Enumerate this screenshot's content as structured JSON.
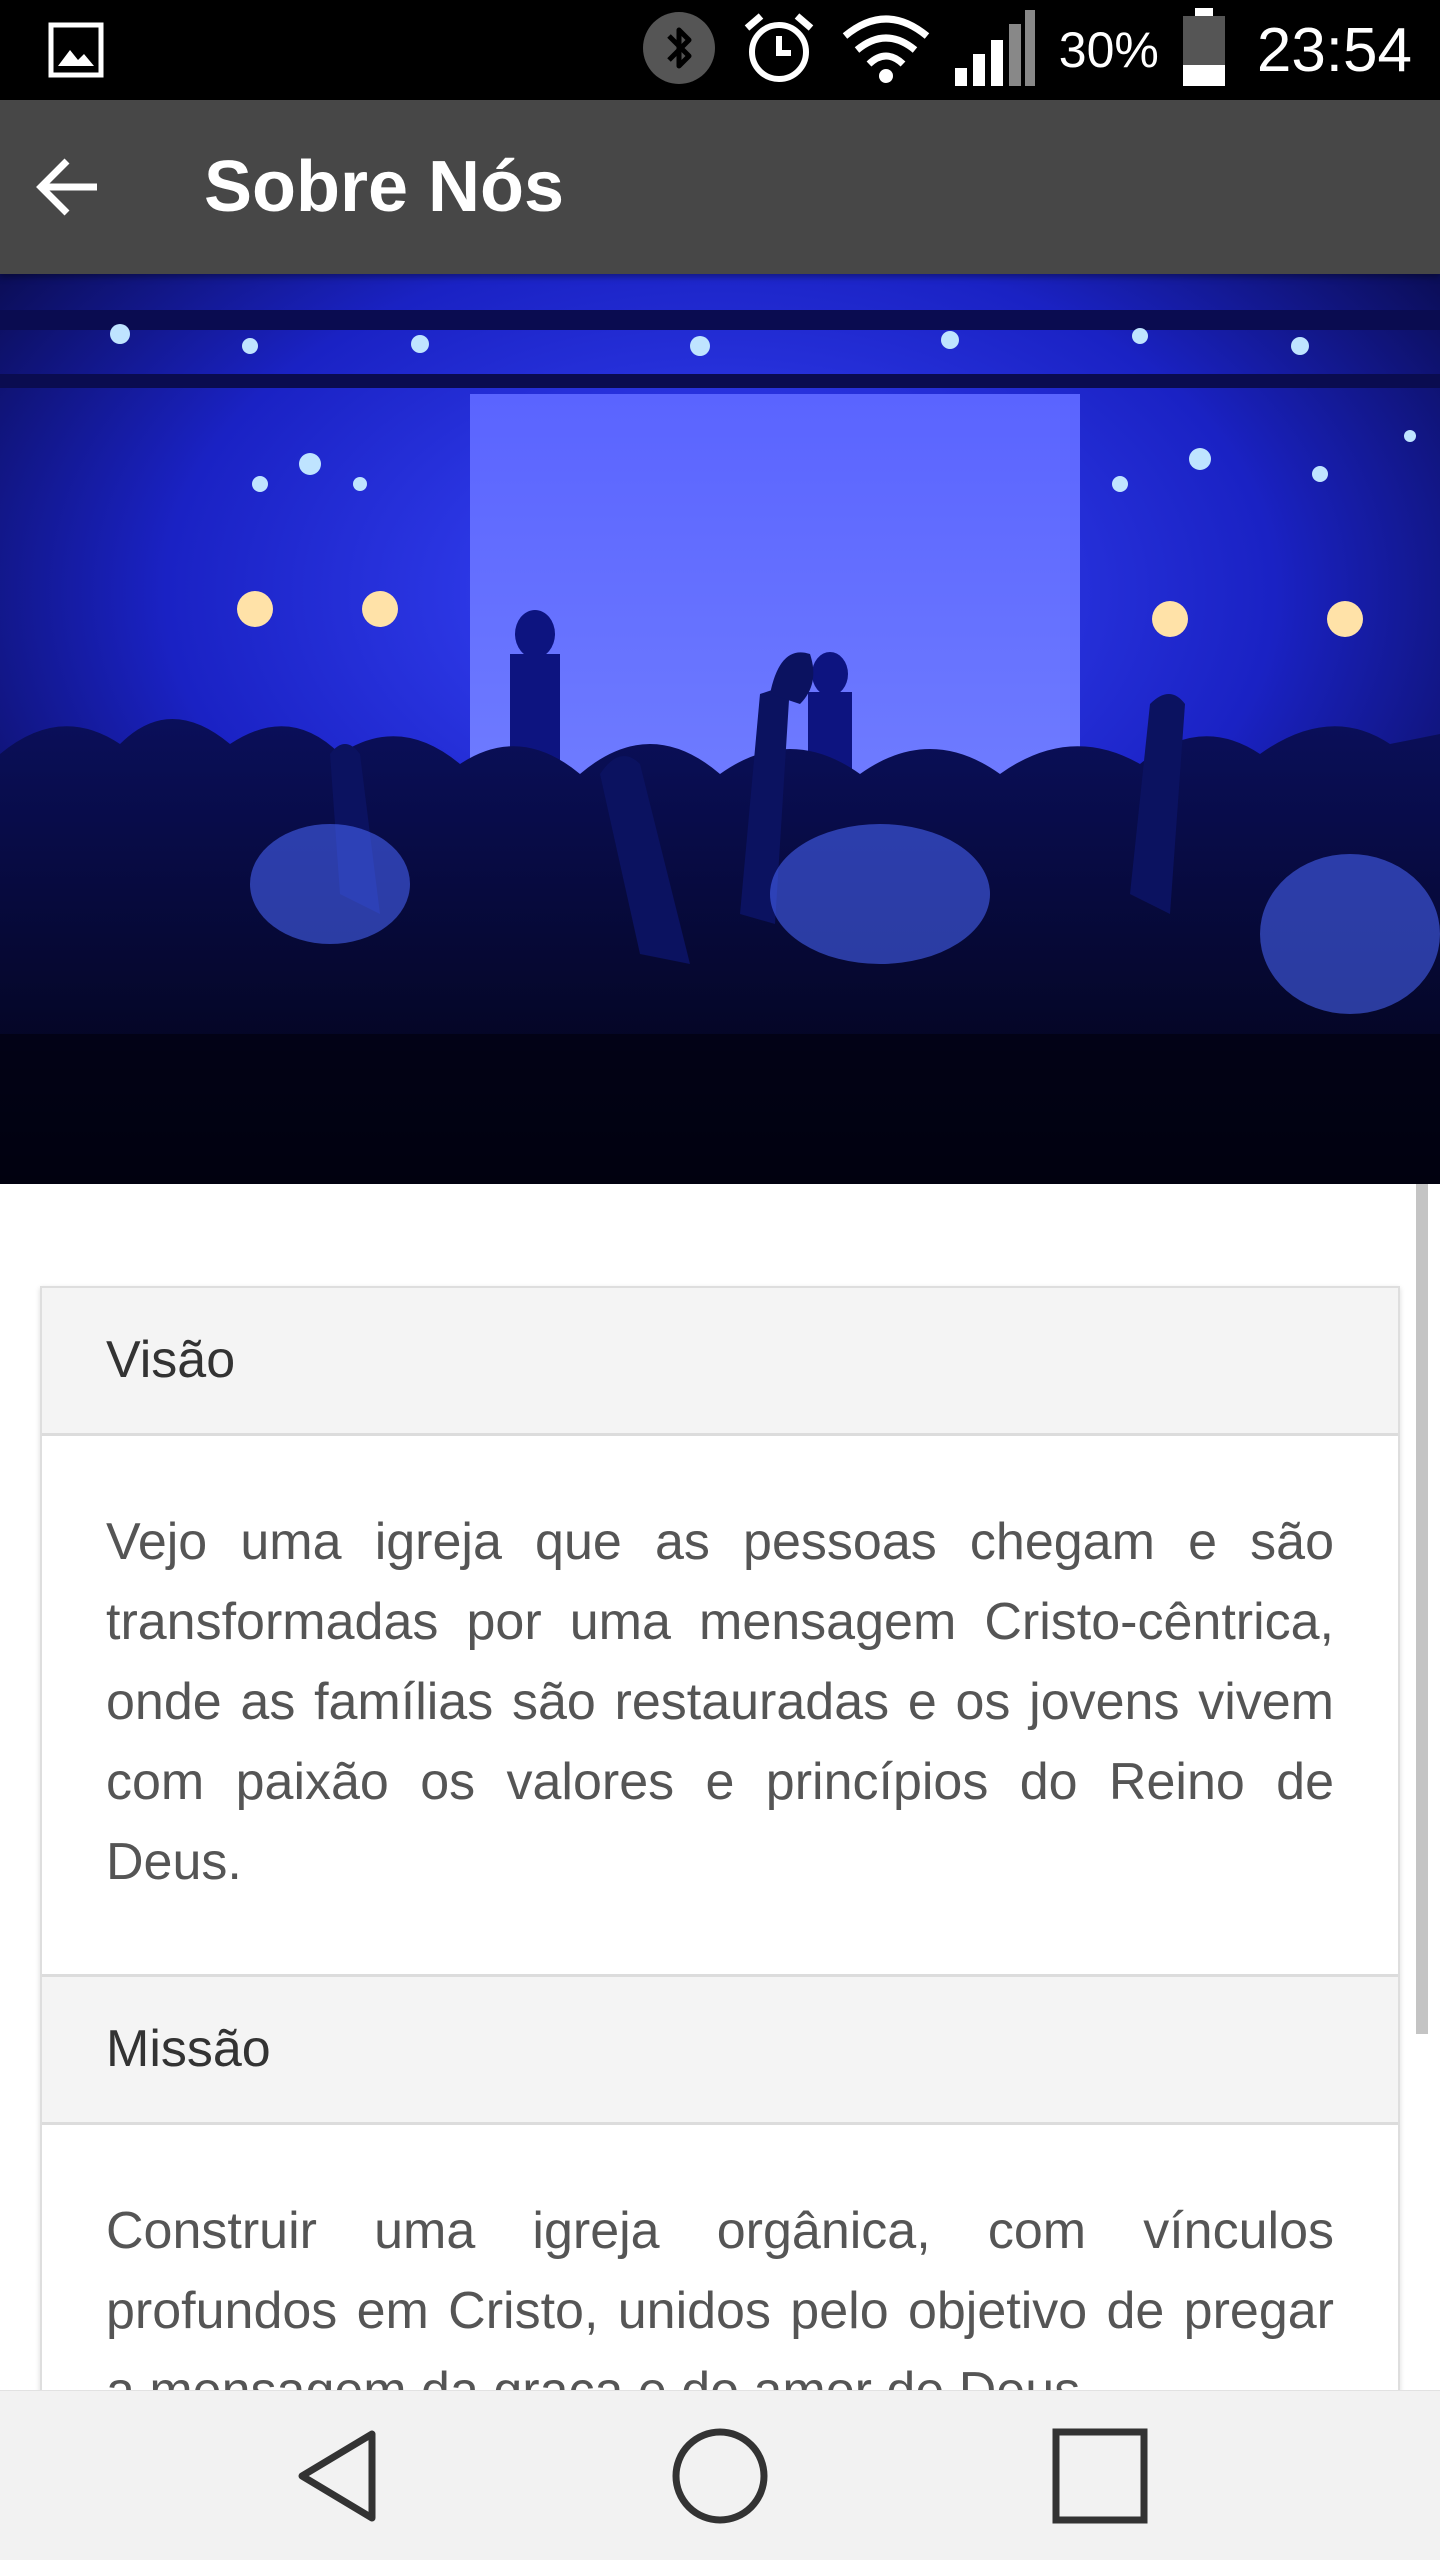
{
  "status_bar": {
    "icons": [
      "image-notification-icon",
      "bluetooth-icon",
      "alarm-icon",
      "wifi-icon",
      "signal-icon",
      "battery-icon"
    ],
    "battery_percent": "30%",
    "battery_level": 0.3,
    "time": "23:54"
  },
  "app_bar": {
    "title": "Sobre Nós",
    "back_icon": "arrow-left-icon"
  },
  "hero": {
    "description": "Concert crowd with raised hands in blue stage light",
    "colors": {
      "main": "#1f2be0",
      "dark": "#05052a"
    }
  },
  "sections": [
    {
      "title": "Visão",
      "body": "Vejo uma igreja que as pessoas chegam e são transformadas por uma mensagem Cristo-cêntrica, onde as famílias são restauradas e os jovens vivem com paixão os valores e princípios do Reino de Deus."
    },
    {
      "title": "Missão",
      "body": "Construir uma igreja orgânica, com vínculos profundos em Cristo, unidos pelo objetivo de pregar a mensagem da graça e do amor de Deus."
    }
  ],
  "nav_bar": {
    "back_icon": "triangle-back-icon",
    "home_icon": "circle-home-icon",
    "recents_icon": "square-recents-icon"
  },
  "colors": {
    "status_bar": "#000000",
    "app_bar": "#474747",
    "panel_header": "#f4f4f4",
    "body_text": "#555555"
  }
}
